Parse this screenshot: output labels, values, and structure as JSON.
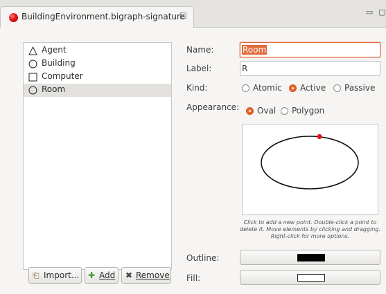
{
  "tab": {
    "title": "BuildingEnvironment.bigraph-signature",
    "close_glyph": "☒",
    "minimize_glyph": "▭",
    "maximize_glyph": "▢"
  },
  "controls": [
    {
      "name": "Agent",
      "shape": "triangle"
    },
    {
      "name": "Building",
      "shape": "circle"
    },
    {
      "name": "Computer",
      "shape": "square"
    },
    {
      "name": "Room",
      "shape": "circle",
      "selected": true
    }
  ],
  "buttons": {
    "import": {
      "label": "Import...",
      "icon": "folder-open-icon"
    },
    "add": {
      "label": "Add",
      "icon": "plus-icon"
    },
    "remove": {
      "label": "Remove",
      "icon": "x-icon"
    }
  },
  "form": {
    "name_label": "Name:",
    "name_value": "Room",
    "label_label": "Label:",
    "label_value": "R",
    "kind_label": "Kind:",
    "kind_options": [
      "Atomic",
      "Active",
      "Passive"
    ],
    "kind_selected": "Active",
    "appearance_label": "Appearance:",
    "appearance_options": [
      "Oval",
      "Polygon"
    ],
    "appearance_selected": "Oval",
    "canvas_hint": "Click to add a new point. Double-click a point to delete it. Move elements by clicking and dragging. Right-click for more options.",
    "outline_label": "Outline:",
    "outline_color": "#000000",
    "fill_label": "Fill:",
    "fill_color": "#ffffff"
  },
  "colors": {
    "accent": "#e8622b",
    "selection": "#e3e1de",
    "point": "#e0141e"
  }
}
